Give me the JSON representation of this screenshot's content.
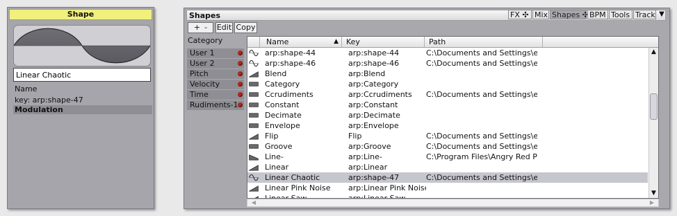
{
  "left": {
    "title": "Shape",
    "name_value": "Linear Chaotic",
    "name_label": "Name",
    "key_label": "key: arp:shape-47",
    "modulation_label": "Modulation"
  },
  "right": {
    "title": "Shapes",
    "tabs": [
      "FX ✣",
      "Mix",
      "Shapes ✣",
      "BPM",
      "Tools",
      "Track"
    ],
    "active_tab": "Shapes",
    "menu_arrow": "▼",
    "toolbar": {
      "add": "+",
      "remove": "-",
      "edit": "Edit",
      "copy": "Copy"
    },
    "category_header": "Category",
    "categories": [
      "User 1",
      "User 2",
      "Pitch",
      "Velocity",
      "Time",
      "Rudiments-1"
    ],
    "columns": {
      "name": "Name",
      "key": "Key",
      "path": "Path",
      "sort_arrow": "▲"
    },
    "rows": [
      {
        "icon": "sine-wave-icon",
        "name": "arp:shape-44",
        "key": "arp:shape-44",
        "path": "C:\\Documents and Settings\\e..."
      },
      {
        "icon": "sine-wave-icon",
        "name": "arp:shape-46",
        "key": "arp:shape-46",
        "path": "C:\\Documents and Settings\\e..."
      },
      {
        "icon": "ramp-icon",
        "name": "Blend",
        "key": "arp:Blend",
        "path": ""
      },
      {
        "icon": "flat-icon",
        "name": "Category",
        "key": "arp:Category",
        "path": ""
      },
      {
        "icon": "flat-icon",
        "name": "Ccrudiments",
        "key": "arp:Ccrudiments",
        "path": "C:\\Documents and Settings\\e..."
      },
      {
        "icon": "flat-icon",
        "name": "Constant",
        "key": "arp:Constant",
        "path": ""
      },
      {
        "icon": "flat-icon",
        "name": "Decimate",
        "key": "arp:Decimate",
        "path": ""
      },
      {
        "icon": "flat-icon",
        "name": "Envelope",
        "key": "arp:Envelope",
        "path": ""
      },
      {
        "icon": "ramp-icon",
        "name": "Flip",
        "key": "Flip",
        "path": "C:\\Documents and Settings\\e..."
      },
      {
        "icon": "flat-icon",
        "name": "Groove",
        "key": "arp:Groove",
        "path": "C:\\Documents and Settings\\e..."
      },
      {
        "icon": "ramp-down-icon",
        "name": "Line-",
        "key": "arp:Line-",
        "path": "C:\\Program Files\\Angry Red Pl..."
      },
      {
        "icon": "ramp-icon",
        "name": "Linear",
        "key": "arp:Linear",
        "path": ""
      },
      {
        "icon": "sine-wave-icon",
        "name": "Linear Chaotic",
        "key": "arp:shape-47",
        "path": "C:\\Documents and Settings\\e..."
      },
      {
        "icon": "ramp-icon",
        "name": "Linear Pink Noise",
        "key": "arp:Linear Pink Noise",
        "path": ""
      },
      {
        "icon": "ramp-icon",
        "name": "Linear Saw",
        "key": "arp:Linear Saw",
        "path": ""
      }
    ],
    "selected_row": 12
  },
  "colors": {
    "title_yellow": "#f1f07c",
    "panel_gray": "#a5a5ab",
    "selected_row": "#c6c6cf",
    "category_dot": "#b3261e"
  }
}
